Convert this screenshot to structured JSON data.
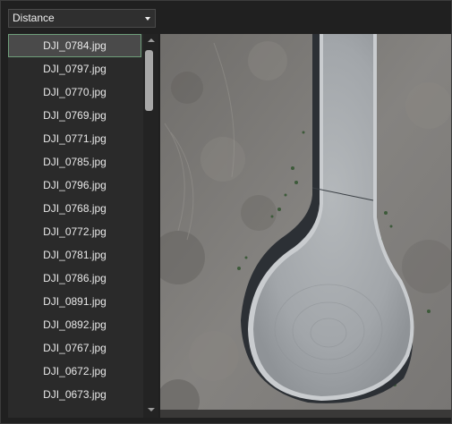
{
  "sort": {
    "selected": "Distance"
  },
  "images": {
    "items": [
      "DJI_0784.jpg",
      "DJI_0797.jpg",
      "DJI_0770.jpg",
      "DJI_0769.jpg",
      "DJI_0771.jpg",
      "DJI_0785.jpg",
      "DJI_0796.jpg",
      "DJI_0768.jpg",
      "DJI_0772.jpg",
      "DJI_0781.jpg",
      "DJI_0786.jpg",
      "DJI_0891.jpg",
      "DJI_0892.jpg",
      "DJI_0767.jpg",
      "DJI_0672.jpg",
      "DJI_0673.jpg"
    ],
    "selected_index": 0
  },
  "colors": {
    "selection_border": "#6e9e7a",
    "road": "#a7abaf",
    "terrain": "#7d7b78"
  },
  "icons": {
    "dropdown": "chevron-down-icon",
    "scroll_up": "scroll-up-arrow-icon",
    "scroll_down": "scroll-down-arrow-icon"
  }
}
